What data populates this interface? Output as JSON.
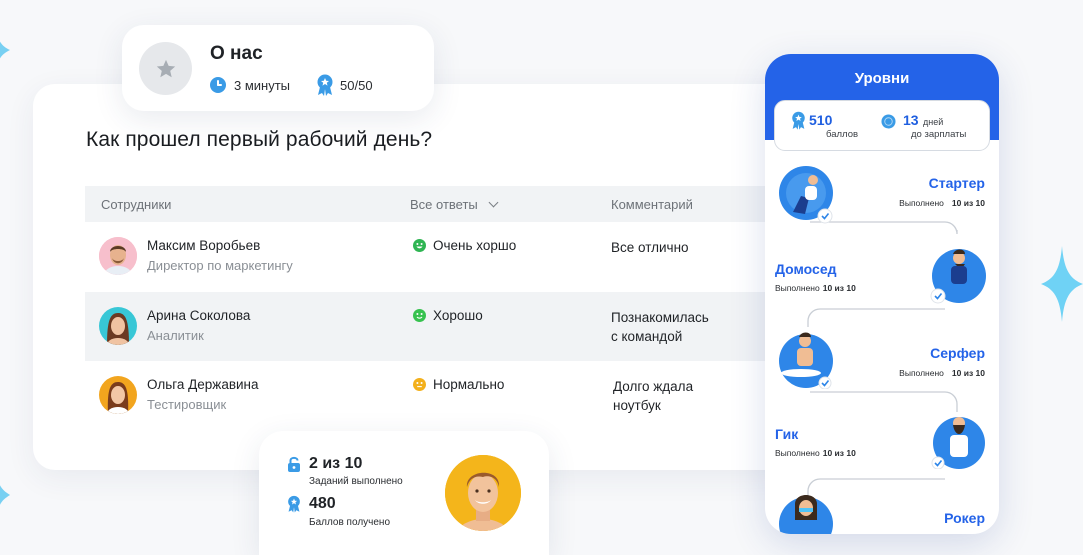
{
  "about": {
    "title": "О нас",
    "duration": "3 минуты",
    "points": "50/50"
  },
  "survey": {
    "title": "Как прошел первый рабочий день?",
    "columns": {
      "employees": "Сотрудники",
      "answers": "Все ответы",
      "comment": "Комментарий"
    },
    "rows": [
      {
        "name": "Максим Воробьев",
        "role": "Директор по маркетингу",
        "mood": "Очень хоршо",
        "mood_color": "#2fb553",
        "comment": "Все отлично"
      },
      {
        "name": "Арина Соколова",
        "role": "Аналитик",
        "mood": "Хорошо",
        "mood_color": "#37c24f",
        "comment": "Познакомилась\nс  командой"
      },
      {
        "name": "Ольга Державина",
        "role": "Тестировщик",
        "mood": "Нормально",
        "mood_color": "#f3b01c",
        "comment": "Долго ждала\nноутбук"
      }
    ]
  },
  "score": {
    "tasks": "2 из 10",
    "tasks_label": "Заданий выполнено",
    "points": "480",
    "points_label": "Баллов получено"
  },
  "levels_panel": {
    "title": "Уровни",
    "points_value": "510",
    "points_label": "баллов",
    "days_value": "13",
    "days_unit": "дней",
    "days_label": "до зарплаты",
    "levels": [
      {
        "name": "Стартер",
        "status": "Выполнено",
        "progress": "10 из 10"
      },
      {
        "name": "Домосед",
        "status": "Выполнено",
        "progress": "10 из 10"
      },
      {
        "name": "Серфер",
        "status": "Выполнено",
        "progress": "10 из 10"
      },
      {
        "name": "Гик",
        "status": "Выполнено",
        "progress": "10 из 10"
      },
      {
        "name": "Рокер"
      }
    ]
  },
  "colors": {
    "accent": "#2463e8",
    "badge": "#3a9be6"
  }
}
